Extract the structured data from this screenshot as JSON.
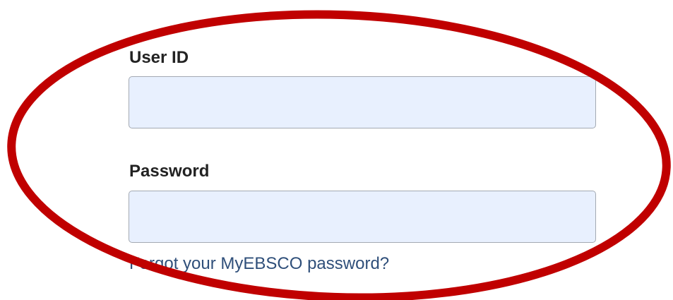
{
  "login_form": {
    "user_id_label": "User ID",
    "user_id_value": "",
    "password_label": "Password",
    "password_value": "",
    "forgot_password_link": "Forgot your MyEBSCO password?"
  },
  "colors": {
    "field_background": "#e8f0fe",
    "link": "#2f4f7a",
    "annotation_ellipse": "#c00000"
  }
}
